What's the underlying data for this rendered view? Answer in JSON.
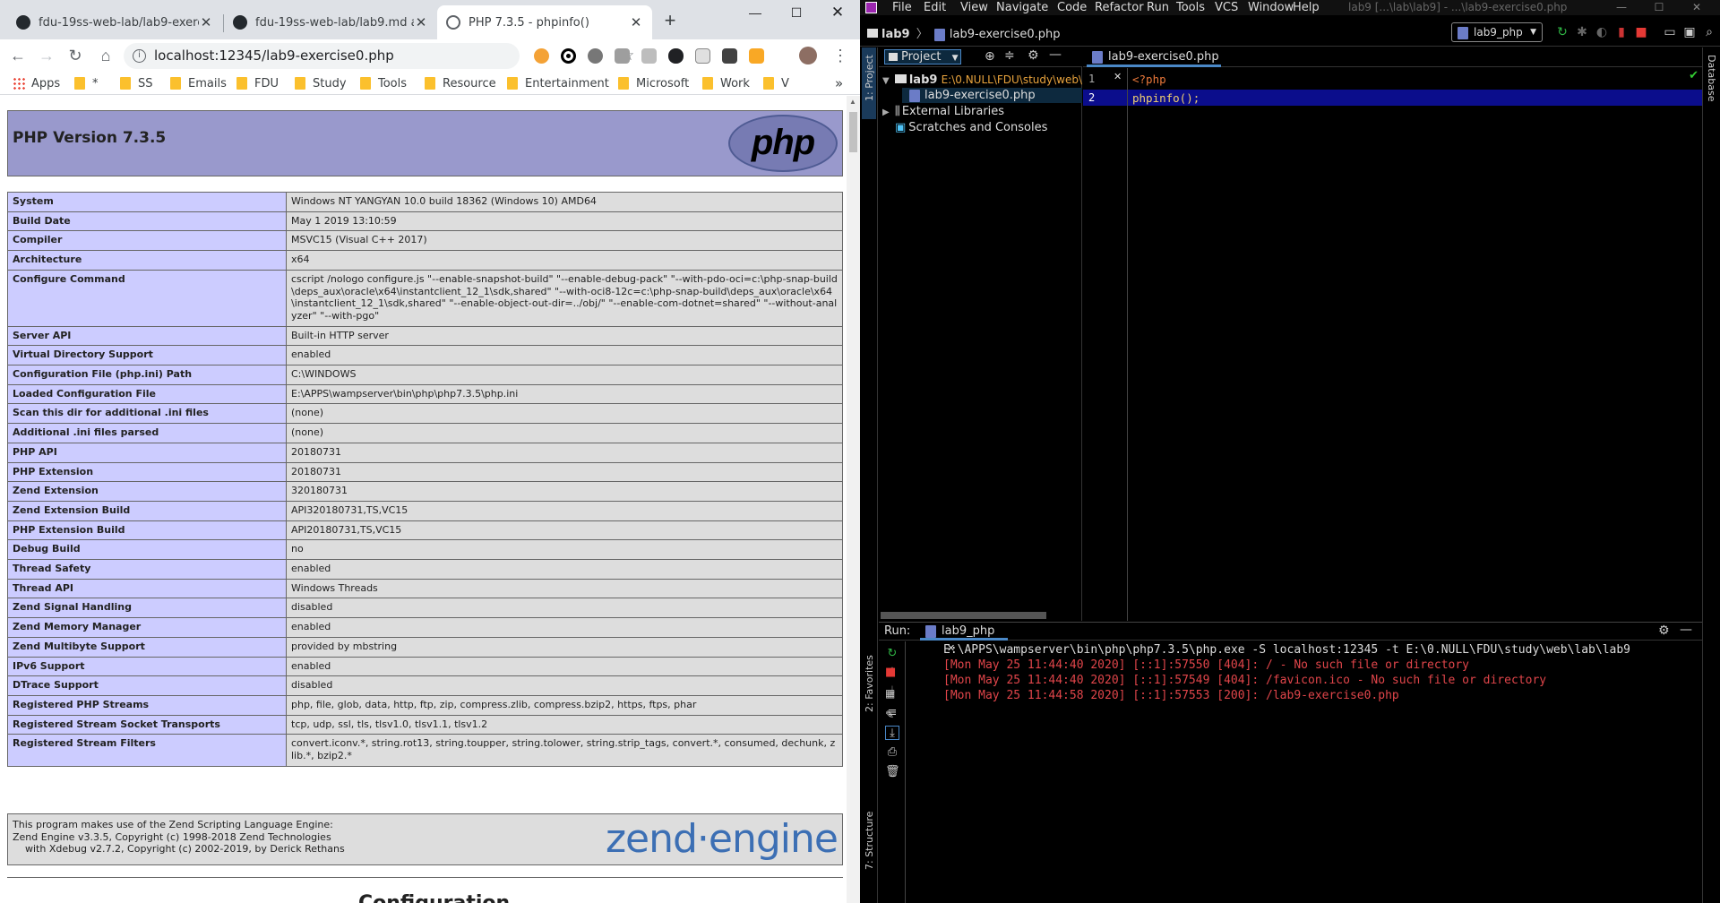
{
  "browser": {
    "tabs": [
      {
        "title": "fdu-19ss-web-lab/lab9-exercis",
        "close": "✕"
      },
      {
        "title": "fdu-19ss-web-lab/lab9.md at r",
        "close": "✕"
      },
      {
        "title": "PHP 7.3.5 - phpinfo()",
        "close": "✕"
      }
    ],
    "new_tab": "+",
    "url": "localhost:12345/lab9-exercise0.php",
    "bookmarks": [
      "Apps",
      "*",
      "SS",
      "Emails",
      "FDU",
      "Study",
      "Tools",
      "Resource",
      "Entertainment",
      "Microsoft",
      "Work",
      "V"
    ],
    "bookmarks_more": "»"
  },
  "phpinfo": {
    "title": "PHP Version 7.3.5",
    "logo": "php",
    "rows": [
      {
        "k": "System",
        "v": "Windows NT YANGYAN 10.0 build 18362 (Windows 10) AMD64"
      },
      {
        "k": "Build Date",
        "v": "May 1 2019 13:10:59"
      },
      {
        "k": "Compiler",
        "v": "MSVC15 (Visual C++ 2017)"
      },
      {
        "k": "Architecture",
        "v": "x64"
      },
      {
        "k": "Configure Command",
        "v": "cscript /nologo configure.js \"--enable-snapshot-build\" \"--enable-debug-pack\" \"--with-pdo-oci=c:\\php-snap-build\\deps_aux\\oracle\\x64\\instantclient_12_1\\sdk,shared\" \"--with-oci8-12c=c:\\php-snap-build\\deps_aux\\oracle\\x64\\instantclient_12_1\\sdk,shared\" \"--enable-object-out-dir=../obj/\" \"--enable-com-dotnet=shared\" \"--without-analyzer\" \"--with-pgo\""
      },
      {
        "k": "Server API",
        "v": "Built-in HTTP server"
      },
      {
        "k": "Virtual Directory Support",
        "v": "enabled"
      },
      {
        "k": "Configuration File (php.ini) Path",
        "v": "C:\\WINDOWS"
      },
      {
        "k": "Loaded Configuration File",
        "v": "E:\\APPS\\wampserver\\bin\\php\\php7.3.5\\php.ini"
      },
      {
        "k": "Scan this dir for additional .ini files",
        "v": "(none)"
      },
      {
        "k": "Additional .ini files parsed",
        "v": "(none)"
      },
      {
        "k": "PHP API",
        "v": "20180731"
      },
      {
        "k": "PHP Extension",
        "v": "20180731"
      },
      {
        "k": "Zend Extension",
        "v": "320180731"
      },
      {
        "k": "Zend Extension Build",
        "v": "API320180731,TS,VC15"
      },
      {
        "k": "PHP Extension Build",
        "v": "API20180731,TS,VC15"
      },
      {
        "k": "Debug Build",
        "v": "no"
      },
      {
        "k": "Thread Safety",
        "v": "enabled"
      },
      {
        "k": "Thread API",
        "v": "Windows Threads"
      },
      {
        "k": "Zend Signal Handling",
        "v": "disabled"
      },
      {
        "k": "Zend Memory Manager",
        "v": "enabled"
      },
      {
        "k": "Zend Multibyte Support",
        "v": "provided by mbstring"
      },
      {
        "k": "IPv6 Support",
        "v": "enabled"
      },
      {
        "k": "DTrace Support",
        "v": "disabled"
      },
      {
        "k": "Registered PHP Streams",
        "v": "php, file, glob, data, http, ftp, zip, compress.zlib, compress.bzip2, https, ftps, phar"
      },
      {
        "k": "Registered Stream Socket Transports",
        "v": "tcp, udp, ssl, tls, tlsv1.0, tlsv1.1, tlsv1.2"
      },
      {
        "k": "Registered Stream Filters",
        "v": "convert.iconv.*, string.rot13, string.toupper, string.tolower, string.strip_tags, convert.*, consumed, dechunk, zlib.*, bzip2.*"
      }
    ],
    "zend_text": "This program makes use of the Zend Scripting Language Engine:\nZend Engine v3.3.5, Copyright (c) 1998-2018 Zend Technologies\n    with Xdebug v2.7.2, Copyright (c) 2002-2019, by Derick Rethans",
    "zend_logo": "zend·engine",
    "next_section": "Configuration"
  },
  "ide": {
    "menu": [
      "File",
      "Edit",
      "View",
      "Navigate",
      "Code",
      "Refactor",
      "Run",
      "Tools",
      "VCS",
      "Window",
      "Help"
    ],
    "window_title": "lab9 [...\\lab\\lab9] - ...\\lab9-exercise0.php",
    "breadcrumb": {
      "project": "lab9",
      "file": "lab9-exercise0.php"
    },
    "run_config": "lab9_php",
    "left_stripe": {
      "project": "1: Project",
      "favorites": "2: Favorites",
      "structure": "7: Structure"
    },
    "right_stripe": "Database",
    "project_panel": {
      "title": "Project",
      "root": "lab9",
      "root_path": "E:\\0.NULL\\FDU\\study\\web\\",
      "file": "lab9-exercise0.php",
      "external": "External Libraries",
      "scratches": "Scratches and Consoles"
    },
    "editor": {
      "tab": "lab9-exercise0.php",
      "lines": [
        {
          "n": "1",
          "code": "<?php"
        },
        {
          "n": "2",
          "code": "phpinfo();"
        }
      ]
    },
    "run": {
      "label": "Run:",
      "tab": "lab9_php",
      "console": [
        {
          "text": "E:\\APPS\\wampserver\\bin\\php\\php7.3.5\\php.exe -S localhost:12345 -t E:\\0.NULL\\FDU\\study\\web\\lab\\lab9",
          "color": "#dddddd"
        },
        {
          "text": "[Mon May 25 11:44:40 2020] [::1]:57550 [404]: / - No such file or directory",
          "color": "#e0454a"
        },
        {
          "text": "[Mon May 25 11:44:40 2020] [::1]:57549 [404]: /favicon.ico - No such file or directory",
          "color": "#e0454a"
        },
        {
          "text": "[Mon May 25 11:44:58 2020] [::1]:57553 [200]: /lab9-exercise0.php",
          "color": "#e0454a"
        }
      ]
    }
  }
}
